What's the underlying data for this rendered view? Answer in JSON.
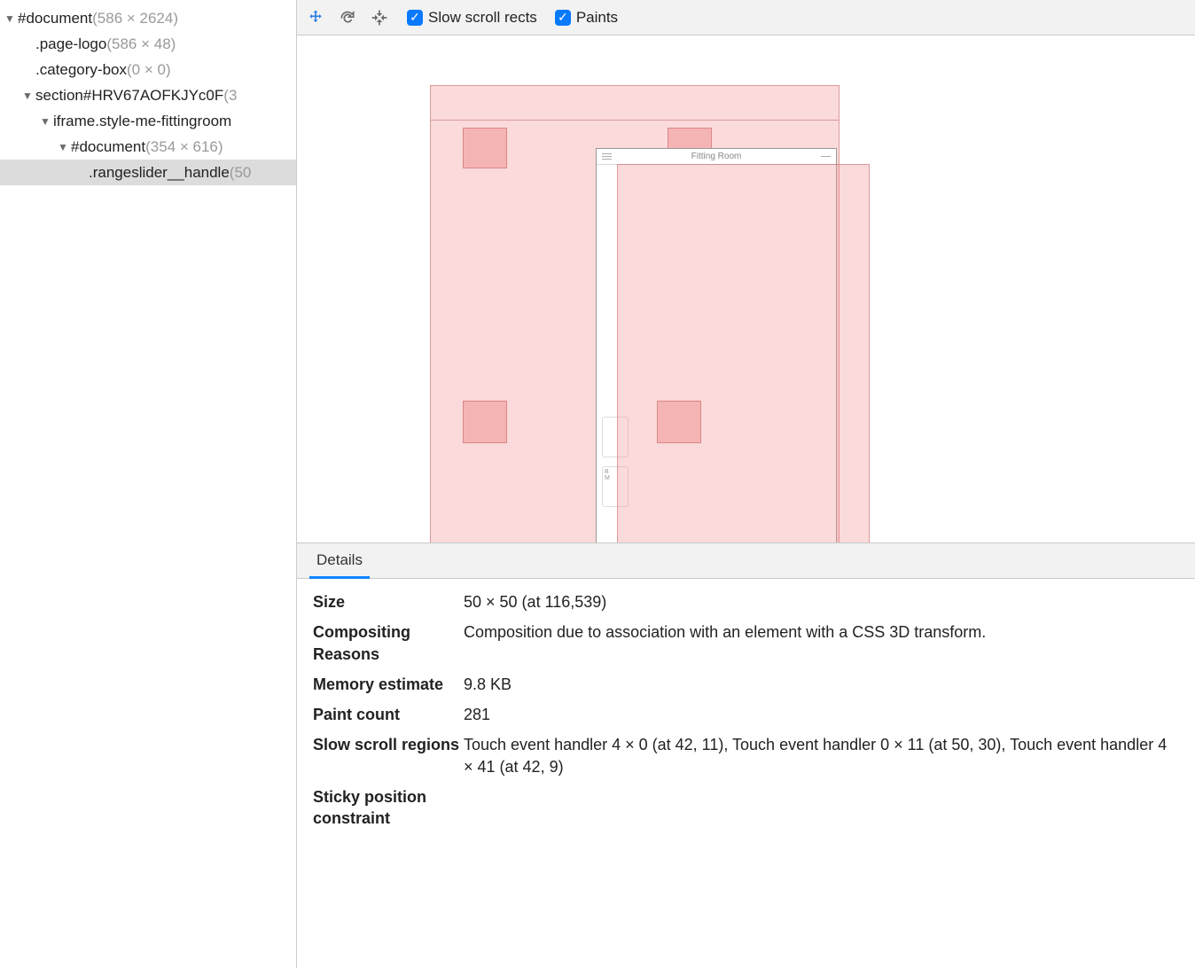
{
  "tree": {
    "items": [
      {
        "indent": 0,
        "arrow": "▼",
        "label": "#document",
        "dim": "(586 × 2624)",
        "selected": false
      },
      {
        "indent": 1,
        "arrow": "",
        "label": ".page-logo",
        "dim": "(586 × 48)",
        "selected": false
      },
      {
        "indent": 1,
        "arrow": "",
        "label": ".category-box",
        "dim": "(0 × 0)",
        "selected": false
      },
      {
        "indent": 1,
        "arrow": "▼",
        "label": "section#HRV67AOFKJYc0F",
        "dim": "(3",
        "selected": false
      },
      {
        "indent": 2,
        "arrow": "▼",
        "label": "iframe.style-me-fittingroom",
        "dim": "",
        "selected": false
      },
      {
        "indent": 3,
        "arrow": "▼",
        "label": "#document",
        "dim": "(354 × 616)",
        "selected": false
      },
      {
        "indent": 4,
        "arrow": "",
        "label": ".rangeslider__handle",
        "dim": "(50",
        "selected": true
      }
    ]
  },
  "toolbar": {
    "checkbox1_label": "Slow scroll rects",
    "checkbox2_label": "Paints"
  },
  "viewer": {
    "fitting_title": "Fitting Room"
  },
  "details": {
    "tab_label": "Details",
    "rows": [
      {
        "label": "Size",
        "value": "50 × 50 (at 116,539)"
      },
      {
        "label": "Compositing Reasons",
        "value": "Composition due to association with an element with a CSS 3D transform."
      },
      {
        "label": "Memory estimate",
        "value": "9.8 KB"
      },
      {
        "label": "Paint count",
        "value": "281"
      },
      {
        "label": "Slow scroll regions",
        "value": "Touch event handler 4 × 0 (at 42, 11), Touch event handler 0 × 11 (at 50, 30), Touch event handler 4 × 41 (at 42, 9)"
      },
      {
        "label": "Sticky position constraint",
        "value": ""
      }
    ]
  }
}
